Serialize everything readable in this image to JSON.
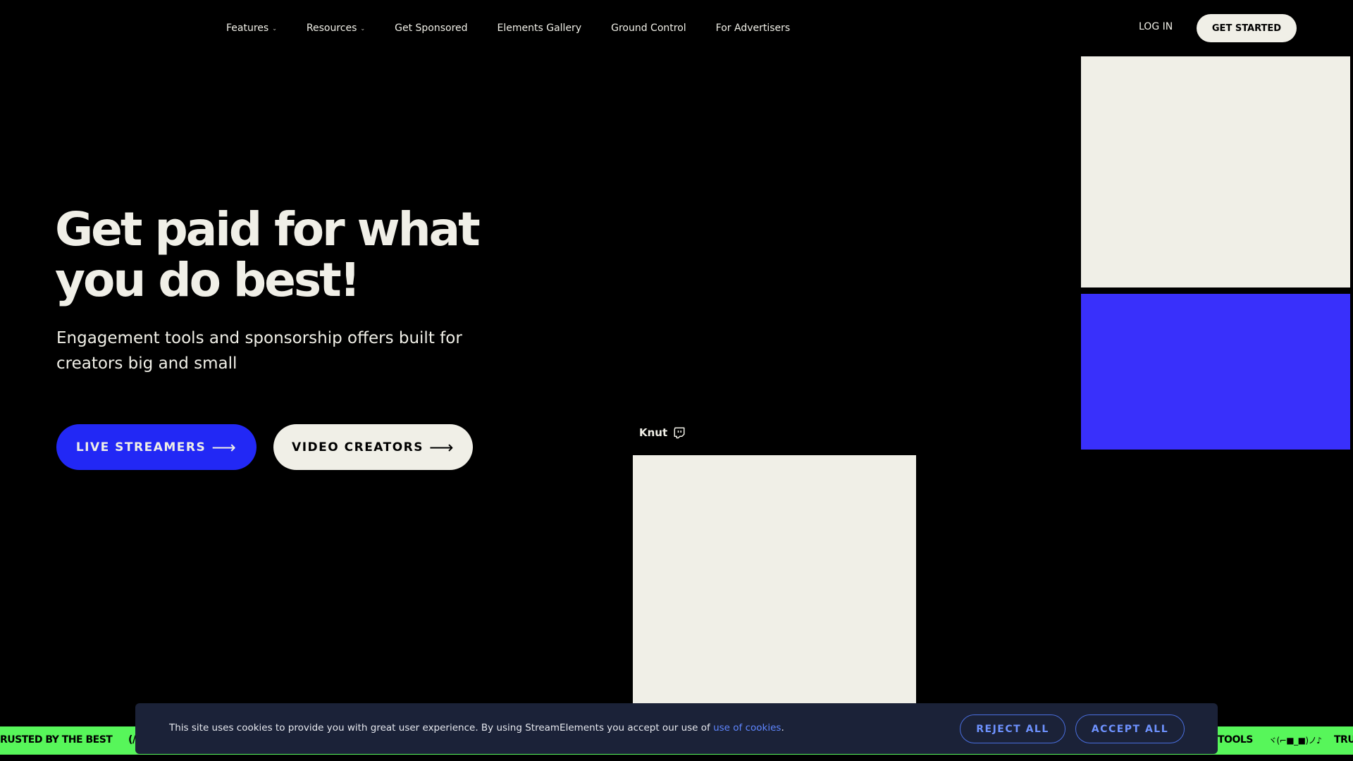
{
  "nav": {
    "items": [
      {
        "label": "Features",
        "dropdown": true
      },
      {
        "label": "Resources",
        "dropdown": true
      },
      {
        "label": "Get Sponsored",
        "dropdown": false
      },
      {
        "label": "Elements Gallery",
        "dropdown": false
      },
      {
        "label": "Ground Control",
        "dropdown": false
      },
      {
        "label": "For Advertisers",
        "dropdown": false
      }
    ],
    "login": "LOG IN",
    "get_started": "GET STARTED"
  },
  "hero": {
    "title_line1": "Get paid for what",
    "title_line2": "you do best!",
    "subtitle_line1": "Engagement tools and sponsorship offers built for",
    "subtitle_line2": "creators big and small",
    "btn_live": "LIVE STREAMERS",
    "btn_video": "VIDEO CREATORS",
    "arrow": "⟶"
  },
  "creator": {
    "name": "Knut",
    "platform_icon": "twitch-icon"
  },
  "ticker": {
    "left_text": "RUSTED BY THE BEST",
    "left_glyph": "(/",
    "right_text": "TOOLS",
    "right_glyph": "ヾ(⌐■_■)ノ♪",
    "right_trail": "TRU"
  },
  "cookie": {
    "text_before": "This site uses cookies to provide you with great user experience. By using StreamElements you accept our use of ",
    "link": "use of cookies",
    "text_after": ".",
    "reject": "REJECT ALL",
    "accept": "ACCEPT ALL"
  },
  "colors": {
    "background": "#000000",
    "cream": "#f0efe7",
    "blue": "#2228f5",
    "panel_blue": "#3930fb",
    "ticker_green": "#57f65a",
    "cookie_bg": "#1b2238",
    "cookie_accent": "#6e92ff"
  }
}
